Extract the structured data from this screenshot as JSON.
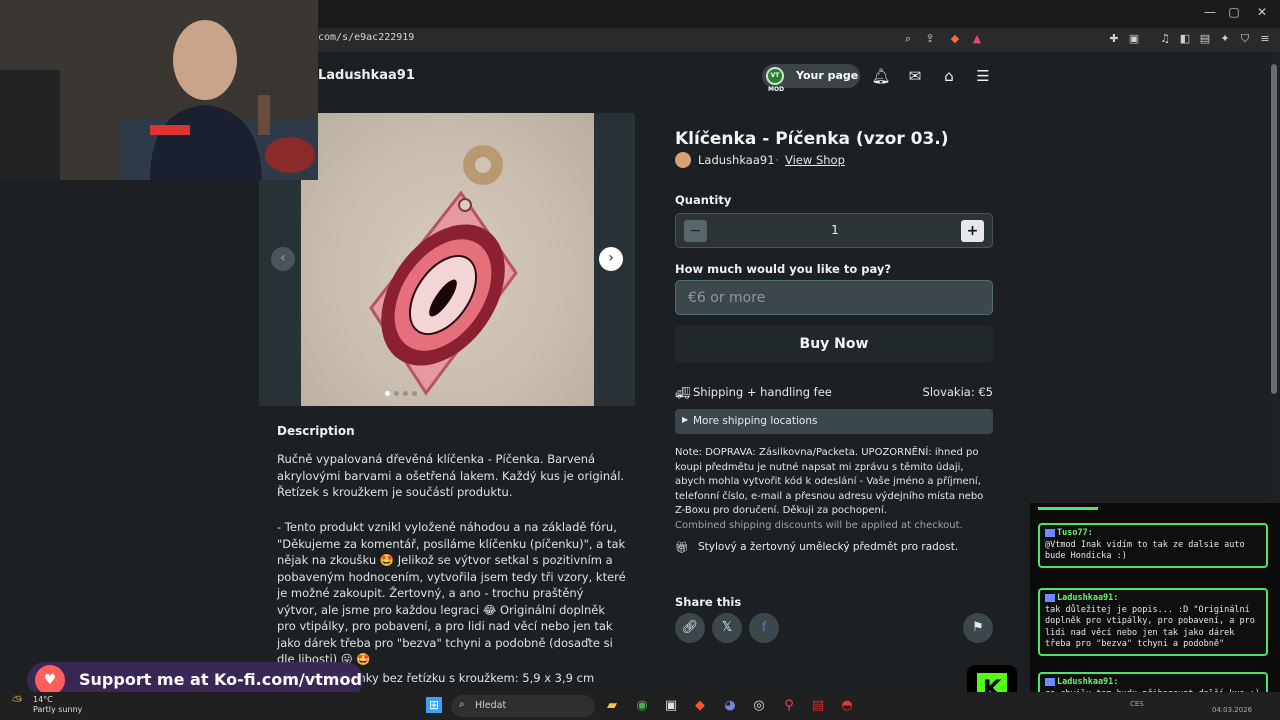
{
  "browser": {
    "url": "com/s/e9ac222919"
  },
  "header": {
    "shop_name": "Ladushkaa91",
    "your_page_label": "Your page",
    "your_page_avatar": "VT MOD"
  },
  "product": {
    "title": "Klíčenka - Píčenka (vzor 03.)",
    "seller": "Ladushkaa91",
    "view_shop": "View Shop",
    "separator": "·",
    "gallery_dots": 4,
    "gallery_active": 1
  },
  "description": {
    "heading": "Description",
    "paragraphs": [
      "Ručně vypalovaná dřevěná klíčenka - Píčenka. Barvená akrylovými barvami a ošetřená lakem. Každý kus je originál. Řetízek s kroužkem je součástí produktu.",
      "- Tento produkt vznikl vyloženě náhodou a na základě fóru, \"Děkujeme za komentář, posíláme klíčenku (píčenku)\", a tak nějak na zkoušku 🤩 Jelikož se výtvor setkal s pozitivním a pobaveným hodnocením, vytvořila jsem tedy tři vzory, které je možné zakoupit. Žertovný, a ano - trochu praštěný výtvor, ale jsme pro každou legraci 😂 Originální doplněk pro vtipálky, pro pobavení, a pro lidi nad věcí nebo jen tak jako dárek třeba pro \"bezva\" tchyni a podobně (dosaďte si dle libosti) 😛 🤩",
      "- Rozměr klíčenky bez řetízku s kroužkem: 5,9 x 3,9 cm"
    ]
  },
  "purchase": {
    "quantity_label": "Quantity",
    "quantity_value": "1",
    "minus": "−",
    "plus": "+",
    "pay_label": "How much would you like to pay?",
    "pay_placeholder": "€6 or more",
    "buy_label": "Buy Now",
    "shipping_label": "Shipping + handling fee",
    "shipping_value": "Slovakia: €5",
    "more_shipping": "More shipping locations",
    "note": "Note: DOPRAVA: Zásilkovna/Packeta. UPOZORNĚNÍ: ihned po koupi předmětu je nutné napsat mi zprávu s těmito údaji, abych mohla vytvořit kód k odeslání - Vaše jméno a příjmení, telefonní číslo, e-mail a přesnou adresu výdejního místa nebo Z-Boxu pro doručení. Děkuji za pochopení.",
    "combined": "Combined shipping discounts will be applied at checkout.",
    "feature": "Stylový a žertovný umělecký předmět pro radost."
  },
  "share": {
    "heading": "Share this"
  },
  "overlay": {
    "kofi_text": "Support me at Ko-fi.com/vtmod",
    "chat": [
      {
        "user": "Tuso77:",
        "text": "@Vtmod Inak vidím to tak ze dalsie auto bude Hondicka :)"
      },
      {
        "user": "Ladushkaa91:",
        "text": "tak důležitej je popis... :D \"Originální doplněk pro vtipálky, pro pobavení, a pro lidi nad věcí nebo jen tak jako dárek třeba pro \"bezva\" tchyni a podobně\""
      },
      {
        "user": "Ladushkaa91:",
        "text": "za chvilu tam budu přihazovat další kus ;)"
      }
    ]
  },
  "taskbar": {
    "temp": "14°C",
    "weather": "Partly sunny",
    "search": "Hledat",
    "lang": "CES",
    "date": "04.03.2026"
  },
  "colors": {
    "page_bg": "#1c2022",
    "panel": "#3b474b",
    "kofi": "#ff5e5b",
    "chat_border": "#4ee36a",
    "kick": "#53fc18"
  }
}
